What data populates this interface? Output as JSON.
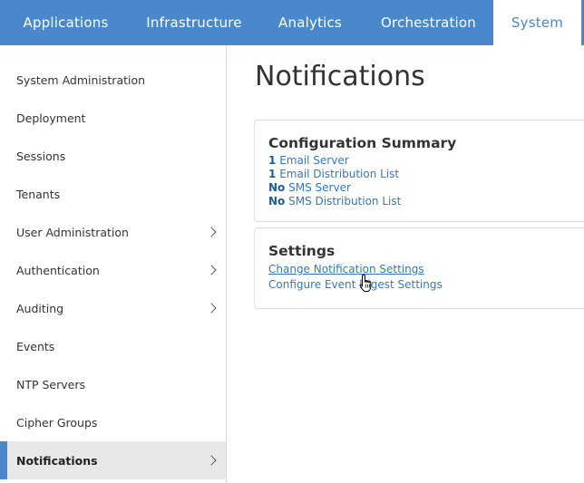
{
  "topnav": {
    "tabs": [
      {
        "label": "Applications",
        "active": false
      },
      {
        "label": "Infrastructure",
        "active": false
      },
      {
        "label": "Analytics",
        "active": false
      },
      {
        "label": "Orchestration",
        "active": false
      },
      {
        "label": "System",
        "active": true
      }
    ]
  },
  "sidebar": {
    "items": [
      {
        "label": "System Administration",
        "chevron": false,
        "active": false
      },
      {
        "label": "Deployment",
        "chevron": false,
        "active": false
      },
      {
        "label": "Sessions",
        "chevron": false,
        "active": false
      },
      {
        "label": "Tenants",
        "chevron": false,
        "active": false
      },
      {
        "label": "User Administration",
        "chevron": true,
        "active": false
      },
      {
        "label": "Authentication",
        "chevron": true,
        "active": false
      },
      {
        "label": "Auditing",
        "chevron": true,
        "active": false
      },
      {
        "label": "Events",
        "chevron": false,
        "active": false
      },
      {
        "label": "NTP Servers",
        "chevron": false,
        "active": false
      },
      {
        "label": "Cipher Groups",
        "chevron": false,
        "active": false
      },
      {
        "label": "Notifications",
        "chevron": true,
        "active": true
      }
    ]
  },
  "main": {
    "title": "Notifications",
    "summary": {
      "heading": "Configuration Summary",
      "lines": [
        {
          "count": "1",
          "text": "Email Server"
        },
        {
          "count": "1",
          "text": "Email Distribution List"
        },
        {
          "count": "No",
          "text": "SMS Server"
        },
        {
          "count": "No",
          "text": "SMS Distribution List"
        }
      ]
    },
    "settings": {
      "heading": "Settings",
      "links": [
        {
          "label": "Change Notification Settings"
        },
        {
          "label": "Configure Event Digest Settings"
        }
      ]
    }
  },
  "colors": {
    "brand": "#4a88cc",
    "link": "#3477c4"
  },
  "icons": {
    "cursor": "hand-pointer-icon",
    "chevron": "chevron-right-icon"
  }
}
